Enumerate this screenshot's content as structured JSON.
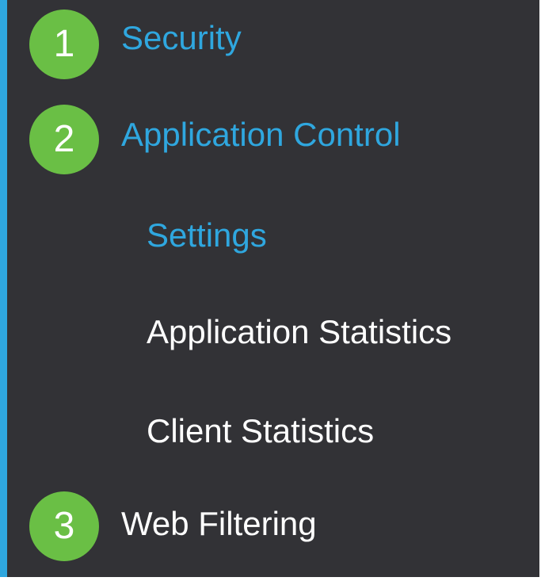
{
  "nav": {
    "accent_color": "#2fa7df",
    "badge_color": "#6abf45",
    "background_color": "#323236",
    "items": [
      {
        "step": "1",
        "label": "Security",
        "state": "active"
      },
      {
        "step": "2",
        "label": "Application Control",
        "state": "active"
      },
      {
        "step": "3",
        "label": "Web Filtering",
        "state": "normal"
      }
    ],
    "subitems": [
      {
        "label": "Settings",
        "state": "active"
      },
      {
        "label": "Application Statistics",
        "state": "normal"
      },
      {
        "label": "Client Statistics",
        "state": "normal"
      }
    ]
  }
}
